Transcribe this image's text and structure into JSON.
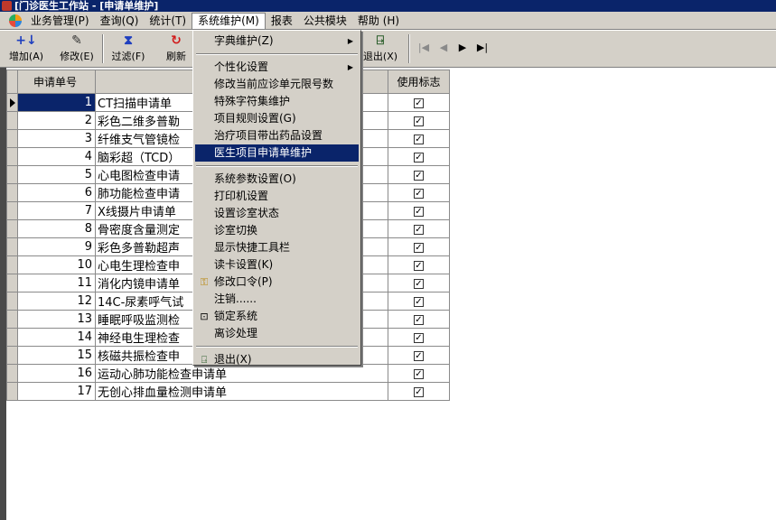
{
  "window": {
    "title": "[门诊医生工作站 - [申请单维护]"
  },
  "menubar": {
    "items": [
      {
        "label": "业务管理(P)"
      },
      {
        "label": "查询(Q)"
      },
      {
        "label": "统计(T)"
      },
      {
        "label": "系统维护(M)"
      },
      {
        "label": "报表"
      },
      {
        "label": "公共模块"
      },
      {
        "label": "帮助 (H)"
      }
    ]
  },
  "toolbar": {
    "add_label": "增加(A)",
    "edit_label": "修改(E)",
    "filter_label": "过滤(F)",
    "refresh_label": "刷新",
    "exit_label": "退出(X)"
  },
  "grid": {
    "columns": {
      "number": "申请单号",
      "flag": "使用标志"
    },
    "rows": [
      {
        "number": "1",
        "name": "CT扫描申请单",
        "flag": "✓"
      },
      {
        "number": "2",
        "name": "彩色二维多普勒",
        "flag": "✓"
      },
      {
        "number": "3",
        "name": "纤维支气管镜检",
        "flag": "✓"
      },
      {
        "number": "4",
        "name": "脑彩超（TCD）",
        "flag": "✓"
      },
      {
        "number": "5",
        "name": "心电图检查申请",
        "flag": "✓"
      },
      {
        "number": "6",
        "name": "肺功能检查申请",
        "flag": "✓"
      },
      {
        "number": "7",
        "name": "X线摄片申请单",
        "flag": "✓"
      },
      {
        "number": "8",
        "name": "骨密度含量测定",
        "flag": "✓"
      },
      {
        "number": "9",
        "name": "彩色多普勒超声",
        "flag": "✓"
      },
      {
        "number": "10",
        "name": "心电生理检查申",
        "flag": "✓"
      },
      {
        "number": "11",
        "name": "消化内镜申请单",
        "flag": "✓"
      },
      {
        "number": "12",
        "name": "14C-尿素呼气试",
        "flag": "✓"
      },
      {
        "number": "13",
        "name": "睡眠呼吸监测检",
        "flag": "✓"
      },
      {
        "number": "14",
        "name": "神经电生理检查",
        "flag": "✓"
      },
      {
        "number": "15",
        "name": "核磁共振检查申",
        "flag": "✓"
      },
      {
        "number": "16",
        "name": "运动心肺功能检查申请单",
        "flag": "✓"
      },
      {
        "number": "17",
        "name": "无创心排血量检测申请单",
        "flag": "✓"
      }
    ]
  },
  "dropdown": {
    "dict": "字典维护(Z)",
    "personal": "个性化设置",
    "modify_unit": "修改当前应诊单元限号数",
    "special_chars": "特殊字符集维护",
    "item_rules": "项目规则设置(G)",
    "treatment_drugs": "治疗项目带出药品设置",
    "request_maint": "医生项目申请单维护",
    "sys_params": "系统参数设置(O)",
    "printer": "打印机设置",
    "room_status": "设置诊室状态",
    "room_switch": "诊室切换",
    "quick_toolbar": "显示快捷工具栏",
    "card_settings": "读卡设置(K)",
    "change_pwd": "修改口令(P)",
    "logout": "注销......",
    "lock": "锁定系统",
    "leave": "离诊处理",
    "exit": "退出(X)"
  },
  "colors": {
    "titlebar": "#0a246a",
    "chrome": "#d4d0c8",
    "selection": "#0a246a"
  }
}
